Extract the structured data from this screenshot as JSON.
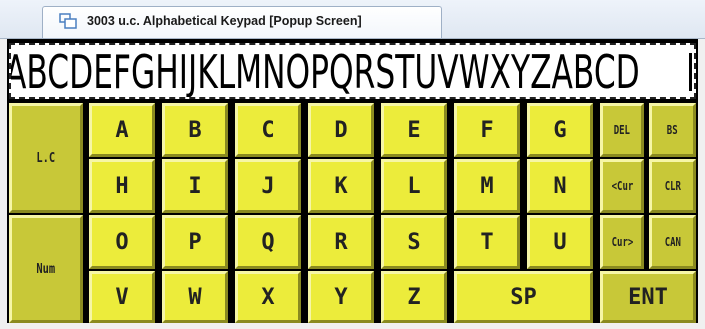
{
  "tab": {
    "title": "3003 u.c. Alphabetical Keypad [Popup Screen]",
    "icon": "screen-window-icon"
  },
  "display": {
    "text": "ABCDEFGHIJKLMNOPQRSTUVWXYZABCD"
  },
  "side_keys": {
    "lc": "L.C",
    "num": "Num"
  },
  "letters": {
    "A": "A",
    "B": "B",
    "C": "C",
    "D": "D",
    "E": "E",
    "F": "F",
    "G": "G",
    "H": "H",
    "I": "I",
    "J": "J",
    "K": "K",
    "L": "L",
    "M": "M",
    "N": "N",
    "O": "O",
    "P": "P",
    "Q": "Q",
    "R": "R",
    "S": "S",
    "T": "T",
    "U": "U",
    "V": "V",
    "W": "W",
    "X": "X",
    "Y": "Y",
    "Z": "Z"
  },
  "func_keys": {
    "del": "DEL",
    "bs": "BS",
    "cur_left": "<Cur",
    "clr": "CLR",
    "cur_right": "Cur>",
    "can": "CAN",
    "sp": "SP",
    "ent": "ENT"
  },
  "colors": {
    "key": "#ecec3b",
    "key_dark": "#c8c838",
    "frame": "#000000"
  }
}
